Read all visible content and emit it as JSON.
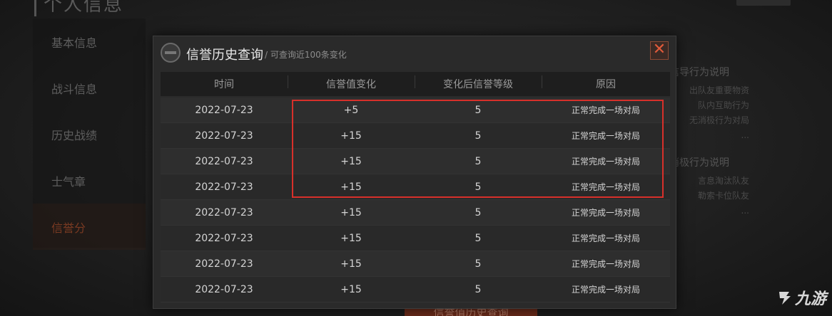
{
  "background": {
    "page_title": "个人信息",
    "sidebar": [
      {
        "label": "基本信息",
        "active": false
      },
      {
        "label": "战斗信息",
        "active": false
      },
      {
        "label": "历史战绩",
        "active": false
      },
      {
        "label": "士气章",
        "active": false
      },
      {
        "label": "信誉分",
        "active": true
      }
    ],
    "right_notes": {
      "positive_title": "信导行为说明",
      "positive_items": [
        "出队友重要物资",
        "队内互助行为",
        "无消极行为对局",
        "..."
      ],
      "negative_title": "消极行为说明",
      "negative_items": [
        "言息淘汰队友",
        "勒索卡位队友",
        "..."
      ]
    },
    "bottom_button": "信誉值历史查询"
  },
  "modal": {
    "title": "信誉历史查询",
    "subtitle": "/ 可查询近100条变化",
    "close_label": "✕",
    "columns": [
      "时间",
      "信誉值变化",
      "变化后信誉等级",
      "原因"
    ],
    "rows": [
      {
        "date": "2022-07-23",
        "change": "+5",
        "level": "5",
        "reason": "正常完成一场对局"
      },
      {
        "date": "2022-07-23",
        "change": "+15",
        "level": "5",
        "reason": "正常完成一场对局"
      },
      {
        "date": "2022-07-23",
        "change": "+15",
        "level": "5",
        "reason": "正常完成一场对局"
      },
      {
        "date": "2022-07-23",
        "change": "+15",
        "level": "5",
        "reason": "正常完成一场对局"
      },
      {
        "date": "2022-07-23",
        "change": "+15",
        "level": "5",
        "reason": "正常完成一场对局"
      },
      {
        "date": "2022-07-23",
        "change": "+15",
        "level": "5",
        "reason": "正常完成一场对局"
      },
      {
        "date": "2022-07-23",
        "change": "+15",
        "level": "5",
        "reason": "正常完成一场对局"
      },
      {
        "date": "2022-07-23",
        "change": "+15",
        "level": "5",
        "reason": "正常完成一场对局"
      }
    ]
  },
  "watermark": "九游",
  "colors": {
    "accent": "#d8302a",
    "close": "#e05a3a"
  }
}
